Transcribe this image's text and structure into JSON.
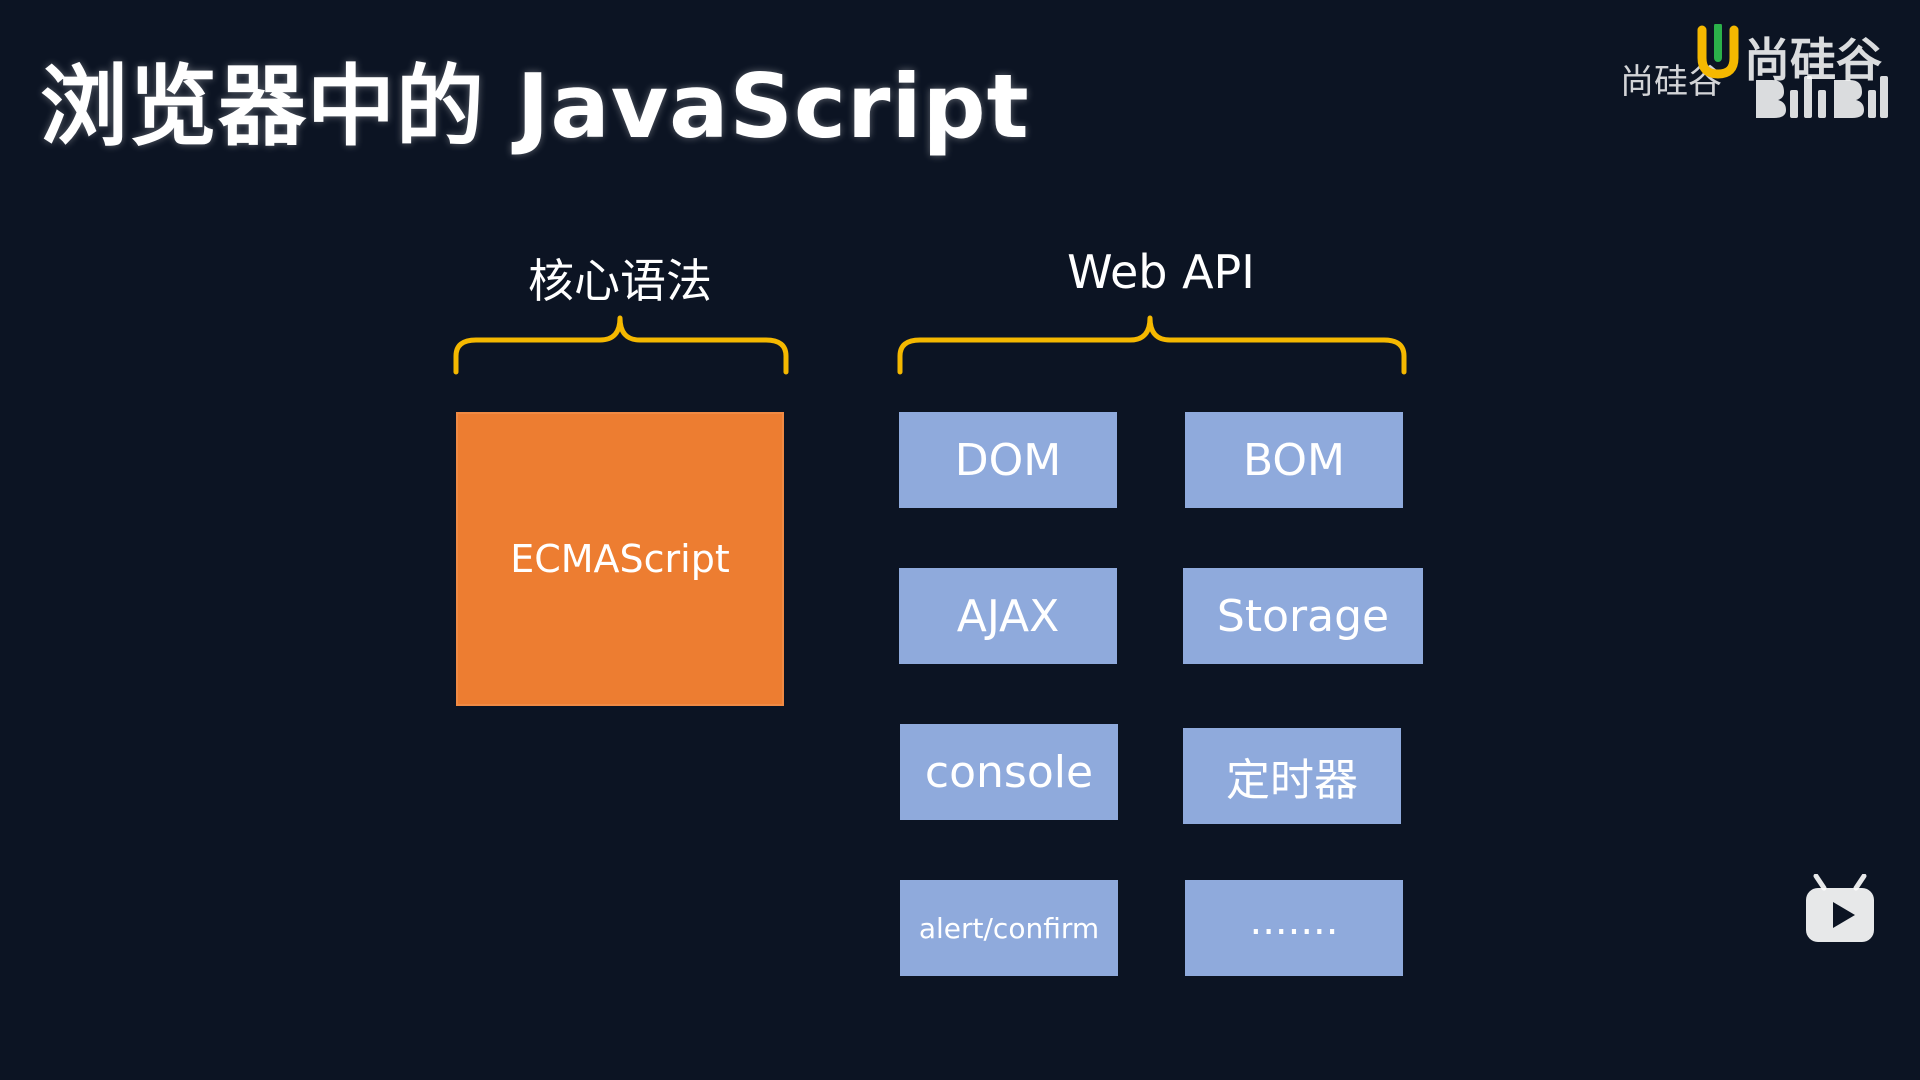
{
  "slide": {
    "title": "浏览器中的 JavaScript"
  },
  "watermark": {
    "text": "尚硅谷",
    "brand": "尚硅谷",
    "logo_icon": "shangguigu-logo-icon",
    "platform_icon": "bilibili-logo-icon"
  },
  "groups": [
    {
      "label": "核心语法",
      "items": [
        "ECMAScript"
      ]
    },
    {
      "label": "Web API",
      "items": [
        "DOM",
        "BOM",
        "AJAX",
        "Storage",
        "console",
        "定时器",
        "alert/confirm",
        "......."
      ]
    }
  ],
  "colors": {
    "background": "#0c1423",
    "core_box": "#ed7d31",
    "api_box": "#8faadc",
    "brace": "#f5b800"
  },
  "overlay": {
    "play_icon": "bilibili-play-icon"
  }
}
